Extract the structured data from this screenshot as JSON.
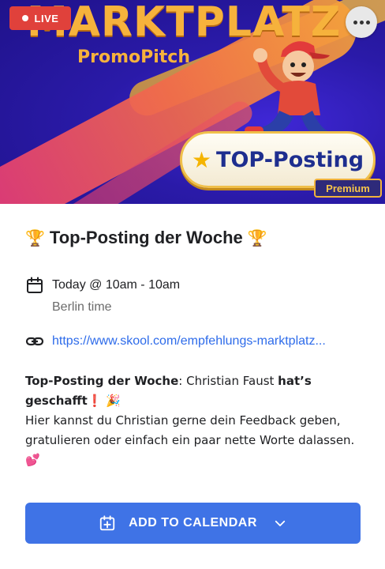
{
  "banner": {
    "title": "MARKTPLATZ",
    "subtitle": "PromoPitch",
    "badge_text": "TOP-Posting",
    "premium_label": "Premium"
  },
  "live_badge": {
    "label": "LIVE"
  },
  "event": {
    "title": "Top-Posting der Woche",
    "date_time": "Today @ 10am - 10am",
    "timezone": "Berlin time",
    "link": "https://www.skool.com/empfehlungs-marktplatz...",
    "description": {
      "bold_1": "Top-Posting der Woche",
      "text_1": ": Christian Faust ",
      "bold_2": "hat’s geschafft",
      "line_2": "Hier kannst du Christian gerne dein Feedback geben, gratulieren oder einfach ein paar nette Worte dalassen."
    }
  },
  "cta": {
    "label": "ADD TO CALENDAR"
  },
  "icons": {
    "more": "more-horizontal-icon",
    "calendar": "calendar-icon",
    "link": "link-icon",
    "add_calendar": "calendar-plus-icon",
    "chevron": "chevron-down-icon"
  },
  "colors": {
    "accent": "#3f73e6",
    "link": "#2d6bea",
    "live": "#e0413b",
    "banner_gold": "#f6b23c",
    "banner_blue": "#2a1aa8"
  }
}
